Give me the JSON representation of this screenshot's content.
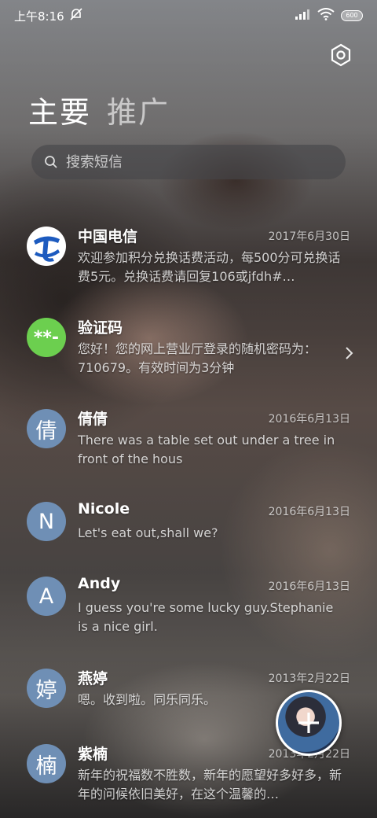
{
  "status": {
    "time": "上午8:16",
    "battery": "600"
  },
  "tabs": [
    {
      "label": "主要",
      "active": true
    },
    {
      "label": "推广",
      "active": false
    }
  ],
  "search": {
    "placeholder": "搜索短信"
  },
  "conversations": [
    {
      "avatar_text": "",
      "avatar_icon": "china-telecom-logo-icon",
      "avatar_color": "#1d5bbf",
      "name": "中国电信",
      "date": "2017年6月30日",
      "preview": "欢迎参加积分兑换话费活动，每500分可兑换话费5元。兑换话费请回复106或jfdh#…"
    },
    {
      "avatar_text": "**-",
      "avatar_color": "#6ccf4f",
      "name": "验证码",
      "date": "",
      "preview": "您好！您的网上营业厅登录的随机密码为：710679。有效时间为3分钟"
    },
    {
      "avatar_text": "倩",
      "avatar_color": "#7494bc",
      "name": "倩倩",
      "date": "2016年6月13日",
      "preview": "There was a table set out under a tree in front of the hous"
    },
    {
      "avatar_text": "N",
      "avatar_color": "#7494bc",
      "name": "Nicole",
      "date": "2016年6月13日",
      "preview": "Let's eat out,shall we?"
    },
    {
      "avatar_text": "A",
      "avatar_color": "#7494bc",
      "name": "Andy",
      "date": "2016年6月13日",
      "preview": "I guess you're some lucky guy.Stephanie is a nice girl."
    },
    {
      "avatar_text": "婷",
      "avatar_color": "#7494bc",
      "name": "燕婷",
      "date": "2013年2月22日",
      "preview": "嗯。收到啦。同乐同乐。"
    },
    {
      "avatar_text": "楠",
      "avatar_color": "#7494bc",
      "name": "紫楠",
      "date": "2013年2月22日",
      "preview": "新年的祝福数不胜数，新年的愿望好多好多，新年的问候依旧美好，在这个温馨的…"
    }
  ],
  "colors": {
    "avatar_default": "#7494bc",
    "telecom_blue": "#1d5bbf",
    "verify_green": "#6ccf4f"
  }
}
